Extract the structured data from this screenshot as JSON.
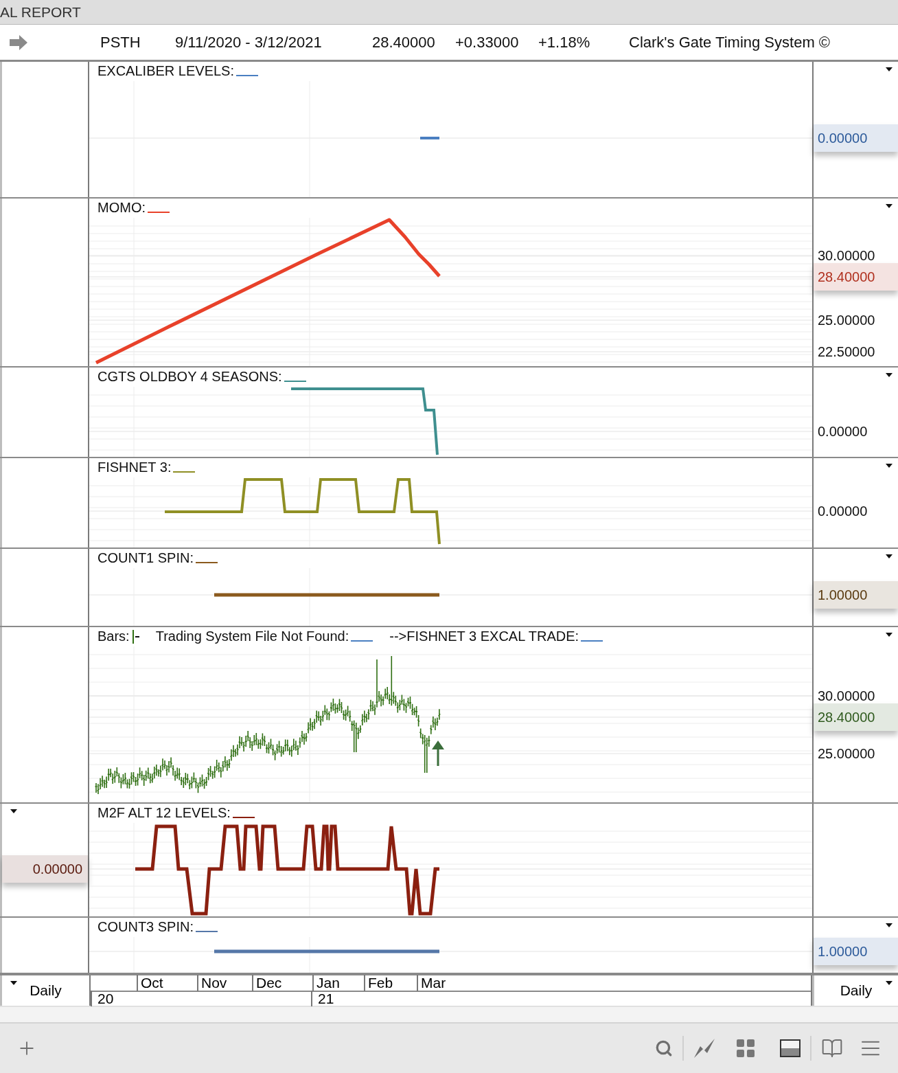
{
  "window": {
    "title": "AL REPORT"
  },
  "header": {
    "symbol": "PSTH",
    "range": "9/11/2020 - 3/12/2021",
    "price": "28.40000",
    "change": "+0.33000",
    "percent": "+1.18%",
    "system": "Clark's Gate Timing System ©"
  },
  "panels": [
    {
      "kind": "excaliber",
      "legends": [
        {
          "label": "EXCALIBER LEVELS:",
          "kind": "line",
          "color": "#4a7fc1"
        }
      ],
      "axis": [
        {
          "text": "0.00000",
          "badge": true,
          "color": "#2c5a9a"
        }
      ]
    },
    {
      "kind": "momo",
      "legends": [
        {
          "label": "MOMO:",
          "kind": "line",
          "color": "#e8412a"
        }
      ],
      "axis": [
        {
          "text": "30.00000",
          "badge": false
        },
        {
          "text": "28.40000",
          "badge": true,
          "color": "#b0301e"
        },
        {
          "text": "25.00000",
          "badge": false
        },
        {
          "text": "22.50000",
          "badge": false
        }
      ]
    },
    {
      "kind": "oldboy",
      "legends": [
        {
          "label": "CGTS OLDBOY 4 SEASONS:",
          "kind": "line",
          "color": "#3f8f8f"
        }
      ],
      "axis": [
        {
          "text": "0.00000",
          "badge": false
        }
      ]
    },
    {
      "kind": "fishnet",
      "legends": [
        {
          "label": "FISHNET 3:",
          "kind": "line",
          "color": "#8f8f24"
        }
      ],
      "axis": [
        {
          "text": "0.00000",
          "badge": false
        }
      ]
    },
    {
      "kind": "count1",
      "legends": [
        {
          "label": "COUNT1 SPIN:",
          "kind": "line",
          "color": "#8b5a1e"
        }
      ],
      "axis": [
        {
          "text": "1.00000",
          "badge": true,
          "color": "#5a3a10"
        }
      ]
    },
    {
      "kind": "bars",
      "legends": [
        {
          "label": "Bars:",
          "kind": "ohlc",
          "color": "#2f6f12"
        },
        {
          "label": "Trading System File Not Found:",
          "kind": "line",
          "color": "#4a7fc1"
        },
        {
          "label": "-->FISHNET 3 EXCAL TRADE:",
          "kind": "line",
          "color": "#4a7fc1"
        }
      ],
      "axis": [
        {
          "text": "30.00000",
          "badge": false
        },
        {
          "text": "28.40000",
          "badge": true,
          "color": "#2f5a1e"
        },
        {
          "text": "25.00000",
          "badge": false
        }
      ]
    },
    {
      "kind": "m2f",
      "legends": [
        {
          "label": "M2F ALT 12 LEVELS:",
          "kind": "line",
          "color": "#8b2010"
        }
      ],
      "left_axis": [
        {
          "text": "0.00000",
          "badge": true,
          "color": "#5a1a0e"
        }
      ]
    },
    {
      "kind": "count3",
      "legends": [
        {
          "label": "COUNT3 SPIN:",
          "kind": "line",
          "color": "#5577a8"
        }
      ],
      "axis": [
        {
          "text": "1.00000",
          "badge": true,
          "color": "#2c5a9a"
        }
      ]
    }
  ],
  "date_axis": {
    "left_label": "Daily",
    "right_label": "Daily",
    "months": [
      "Oct",
      "Nov",
      "Dec",
      "Jan",
      "Feb",
      "Mar"
    ],
    "years": [
      "20",
      "21"
    ]
  }
}
